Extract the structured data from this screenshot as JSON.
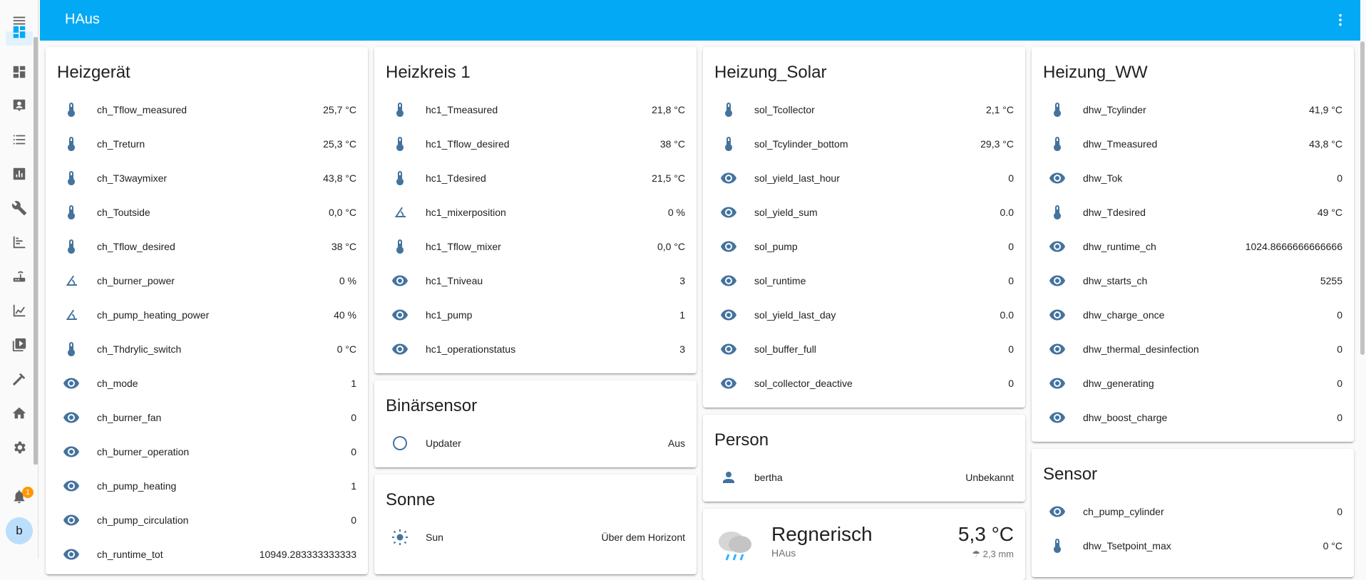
{
  "app": {
    "title": "HAus"
  },
  "colors": {
    "header": "#03a9f4",
    "icon": "#44739e",
    "badge": "#ff9800"
  },
  "sidebar": {
    "items": [
      "menu-icon",
      "dashboard-icon",
      "map-icon",
      "logbook-icon",
      "history-icon",
      "wrench-icon",
      "chart-icon",
      "router-icon",
      "area-chart-icon",
      "media-icon",
      "hammer-icon",
      "home-gear-icon",
      "gear-icon"
    ],
    "notification_count": "1",
    "avatar_letter": "b"
  },
  "cards": {
    "heizgeraet": {
      "title": "Heizgerät",
      "rows": [
        {
          "icon": "thermometer",
          "name": "ch_Tflow_measured",
          "value": "25,7 °C"
        },
        {
          "icon": "thermometer",
          "name": "ch_Treturn",
          "value": "25,3 °C"
        },
        {
          "icon": "thermometer",
          "name": "ch_T3waymixer",
          "value": "43,8 °C"
        },
        {
          "icon": "thermometer",
          "name": "ch_Toutside",
          "value": "0,0 °C"
        },
        {
          "icon": "thermometer",
          "name": "ch_Tflow_desired",
          "value": "38 °C"
        },
        {
          "icon": "angle",
          "name": "ch_burner_power",
          "value": "0 %"
        },
        {
          "icon": "angle",
          "name": "ch_pump_heating_power",
          "value": "40 %"
        },
        {
          "icon": "thermometer",
          "name": "ch_Thdrylic_switch",
          "value": "0 °C"
        },
        {
          "icon": "eye",
          "name": "ch_mode",
          "value": "1"
        },
        {
          "icon": "eye",
          "name": "ch_burner_fan",
          "value": "0"
        },
        {
          "icon": "eye",
          "name": "ch_burner_operation",
          "value": "0"
        },
        {
          "icon": "eye",
          "name": "ch_pump_heating",
          "value": "1"
        },
        {
          "icon": "eye",
          "name": "ch_pump_circulation",
          "value": "0"
        },
        {
          "icon": "eye",
          "name": "ch_runtime_tot",
          "value": "10949.283333333333"
        }
      ]
    },
    "heizkreis": {
      "title": "Heizkreis 1",
      "rows": [
        {
          "icon": "thermometer",
          "name": "hc1_Tmeasured",
          "value": "21,8 °C"
        },
        {
          "icon": "thermometer",
          "name": "hc1_Tflow_desired",
          "value": "38 °C"
        },
        {
          "icon": "thermometer",
          "name": "hc1_Tdesired",
          "value": "21,5 °C"
        },
        {
          "icon": "angle",
          "name": "hc1_mixerposition",
          "value": "0 %"
        },
        {
          "icon": "thermometer",
          "name": "hc1_Tflow_mixer",
          "value": "0,0 °C"
        },
        {
          "icon": "eye",
          "name": "hc1_Tniveau",
          "value": "3"
        },
        {
          "icon": "eye",
          "name": "hc1_pump",
          "value": "1"
        },
        {
          "icon": "eye",
          "name": "hc1_operationstatus",
          "value": "3"
        }
      ]
    },
    "binaersensor": {
      "title": "Binärsensor",
      "rows": [
        {
          "icon": "circle",
          "name": "Updater",
          "value": "Aus"
        }
      ]
    },
    "sonne": {
      "title": "Sonne",
      "rows": [
        {
          "icon": "sun",
          "name": "Sun",
          "value": "Über dem Horizont"
        }
      ]
    },
    "solar": {
      "title": "Heizung_Solar",
      "rows": [
        {
          "icon": "thermometer",
          "name": "sol_Tcollector",
          "value": "2,1 °C"
        },
        {
          "icon": "thermometer",
          "name": "sol_Tcylinder_bottom",
          "value": "29,3 °C"
        },
        {
          "icon": "eye",
          "name": "sol_yield_last_hour",
          "value": "0"
        },
        {
          "icon": "eye",
          "name": "sol_yield_sum",
          "value": "0.0"
        },
        {
          "icon": "eye",
          "name": "sol_pump",
          "value": "0"
        },
        {
          "icon": "eye",
          "name": "sol_runtime",
          "value": "0"
        },
        {
          "icon": "eye",
          "name": "sol_yield_last_day",
          "value": "0.0"
        },
        {
          "icon": "eye",
          "name": "sol_buffer_full",
          "value": "0"
        },
        {
          "icon": "eye",
          "name": "sol_collector_deactive",
          "value": "0"
        }
      ]
    },
    "person": {
      "title": "Person",
      "rows": [
        {
          "icon": "account",
          "name": "bertha",
          "value": "Unbekannt"
        }
      ]
    },
    "weather": {
      "condition": "Regnerisch",
      "name": "HAus",
      "temperature": "5,3 °C",
      "precipitation": "2,3 mm"
    },
    "ww": {
      "title": "Heizung_WW",
      "rows": [
        {
          "icon": "thermometer",
          "name": "dhw_Tcylinder",
          "value": "41,9 °C"
        },
        {
          "icon": "thermometer",
          "name": "dhw_Tmeasured",
          "value": "43,8 °C"
        },
        {
          "icon": "eye",
          "name": "dhw_Tok",
          "value": "0"
        },
        {
          "icon": "thermometer",
          "name": "dhw_Tdesired",
          "value": "49 °C"
        },
        {
          "icon": "eye",
          "name": "dhw_runtime_ch",
          "value": "1024.8666666666666"
        },
        {
          "icon": "eye",
          "name": "dhw_starts_ch",
          "value": "5255"
        },
        {
          "icon": "eye",
          "name": "dhw_charge_once",
          "value": "0"
        },
        {
          "icon": "eye",
          "name": "dhw_thermal_desinfection",
          "value": "0"
        },
        {
          "icon": "eye",
          "name": "dhw_generating",
          "value": "0"
        },
        {
          "icon": "eye",
          "name": "dhw_boost_charge",
          "value": "0"
        }
      ]
    },
    "sensor": {
      "title": "Sensor",
      "rows": [
        {
          "icon": "eye",
          "name": "ch_pump_cylinder",
          "value": "0"
        },
        {
          "icon": "thermometer",
          "name": "dhw_Tsetpoint_max",
          "value": "0 °C"
        }
      ]
    }
  }
}
